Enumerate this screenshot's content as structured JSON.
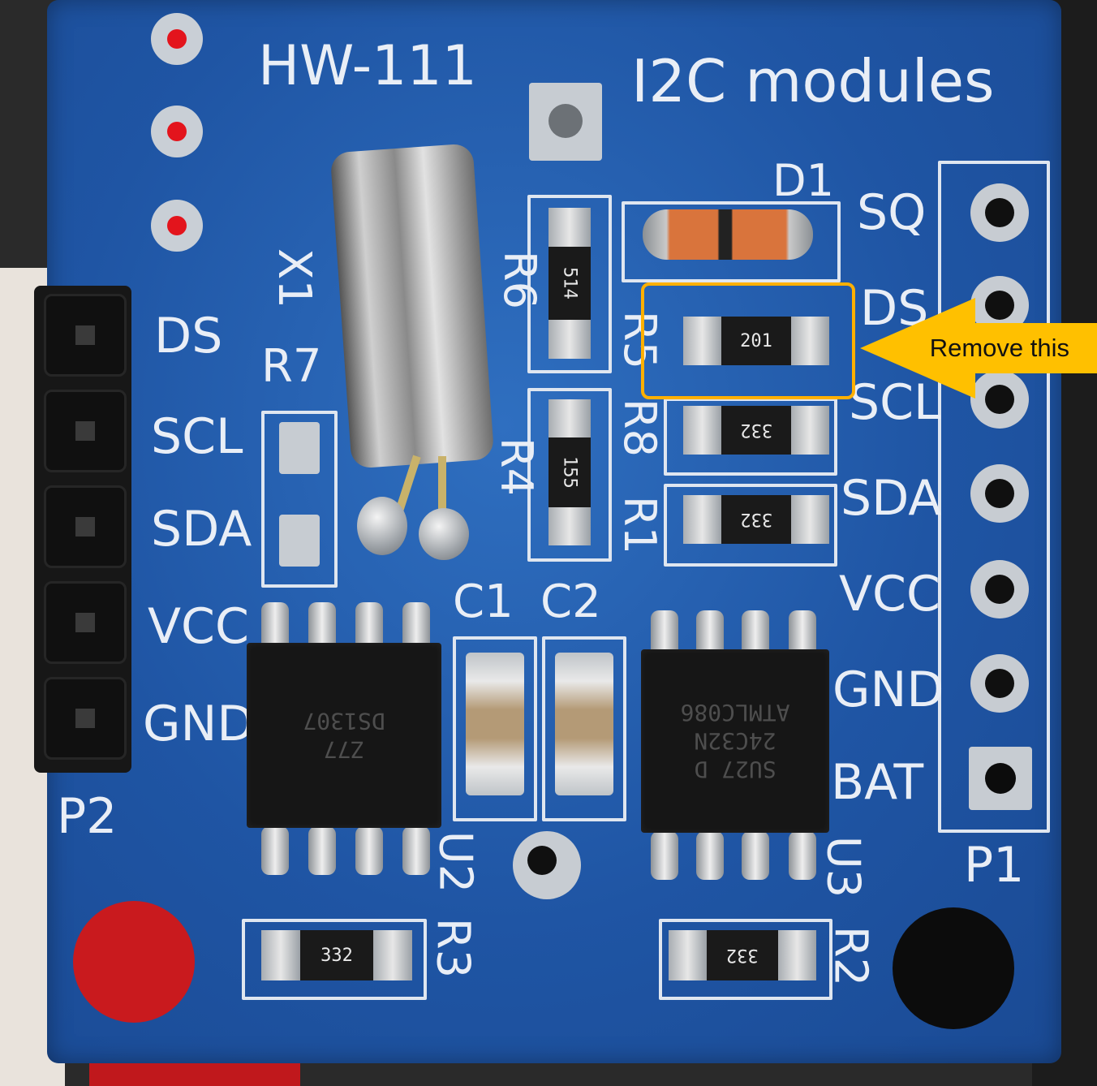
{
  "board": {
    "model": "HW-111",
    "subtitle": "I2C modules"
  },
  "labels": {
    "x1": "X1",
    "r7": "R7",
    "r6": "R6",
    "r5": "R5",
    "r8": "R8",
    "r4": "R4",
    "r1": "R1",
    "d1": "D1",
    "c1": "C1",
    "c2": "C2",
    "u2": "U2",
    "u3": "U3",
    "r3": "R3",
    "r2": "R2",
    "p1": "P1",
    "p2": "P2"
  },
  "p2_pins": [
    "DS",
    "SCL",
    "SDA",
    "VCC",
    "GND"
  ],
  "p1_pins": [
    "SQ",
    "DS",
    "SCL",
    "SDA",
    "VCC",
    "GND",
    "BAT"
  ],
  "resistor_codes": {
    "r6": "514",
    "r5": "201",
    "r4": "155",
    "r8": "332",
    "r1": "332",
    "r3": "332",
    "r2": "332"
  },
  "chips": {
    "u2": [
      "DS1307",
      "Z77"
    ],
    "u3": [
      "ATMLC086",
      "24C32N",
      "SU27 D"
    ]
  },
  "annotation": {
    "text": "Remove this",
    "color": "#ffc000"
  }
}
